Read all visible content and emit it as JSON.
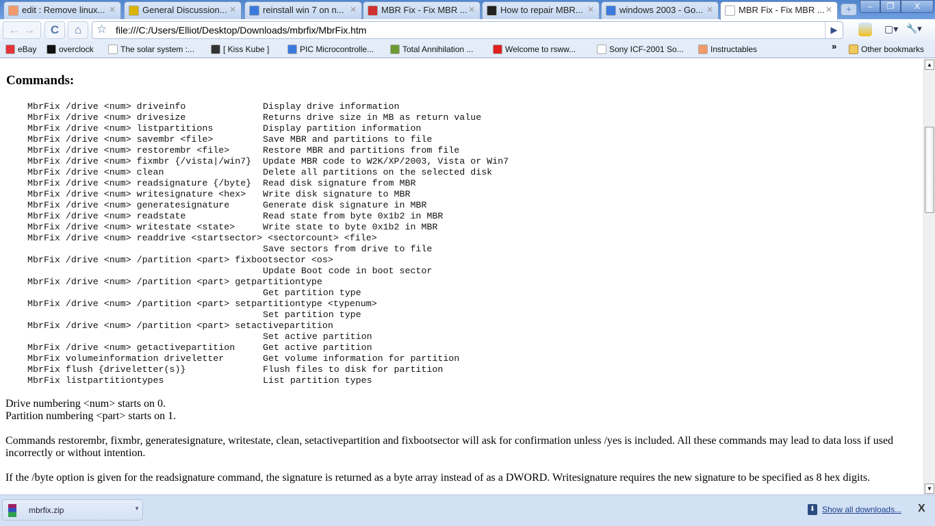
{
  "tabs": [
    {
      "title": "edit : Remove linux...",
      "icon": "instructables-icon",
      "color": "#f39a6b"
    },
    {
      "title": "General Discussion...",
      "icon": "k-logo-icon",
      "color": "#d8b400"
    },
    {
      "title": "reinstall win 7 on n...",
      "icon": "google-icon",
      "color": "#3a7ae0"
    },
    {
      "title": "MBR Fix - Fix MBR ...",
      "icon": "mbrfix-icon",
      "color": "#d03030"
    },
    {
      "title": "How to repair MBR...",
      "icon": "circle-logo-icon",
      "color": "#222222"
    },
    {
      "title": "windows 2003 - Go...",
      "icon": "google-icon",
      "color": "#3a7ae0"
    },
    {
      "title": "MBR Fix - Fix MBR ...",
      "icon": "page-icon",
      "color": "#ffffff",
      "active": true
    }
  ],
  "window_controls": {
    "minimize": "–",
    "maximize": "❐",
    "close": "X"
  },
  "toolbar": {
    "back": "←",
    "forward": "→",
    "reload": "C",
    "home": "⌂",
    "url": "file:///C:/Users/Elliot/Desktop/Downloads/mbrfix/MbrFix.htm",
    "go": "▶",
    "page": "▢▾",
    "wrench": "🔧▾"
  },
  "bookmarks": [
    {
      "label": "eBay",
      "color": "#e53238"
    },
    {
      "label": "overclock",
      "color": "#111111"
    },
    {
      "label": "The solar system :...",
      "color": "#ffffff"
    },
    {
      "label": "[  Kiss Kube  ]",
      "color": "#333333"
    },
    {
      "label": "PIC Microcontrolle...",
      "color": "#3a7ae0"
    },
    {
      "label": "Total Annihilation ...",
      "color": "#6a9a30"
    },
    {
      "label": "Welcome to rsww...",
      "color": "#e02020"
    },
    {
      "label": "Sony ICF-2001 So...",
      "color": "#ffffff"
    },
    {
      "label": "Instructables",
      "color": "#f39a6b"
    }
  ],
  "bookmarks_more": "»",
  "other_bookmarks": "Other bookmarks",
  "content": {
    "heading": "Commands:",
    "commands": [
      [
        "MbrFix /drive <num> driveinfo",
        "Display drive information"
      ],
      [
        "MbrFix /drive <num> drivesize",
        "Returns drive size in MB as return value"
      ],
      [
        "MbrFix /drive <num> listpartitions",
        "Display partition information"
      ],
      [
        "MbrFix /drive <num> savembr <file>",
        "Save MBR and partitions to file"
      ],
      [
        "MbrFix /drive <num> restorembr <file>",
        "Restore MBR and partitions from file"
      ],
      [
        "MbrFix /drive <num> fixmbr {/vista|/win7}",
        "Update MBR code to W2K/XP/2003, Vista or Win7"
      ],
      [
        "MbrFix /drive <num> clean",
        "Delete all partitions on the selected disk"
      ],
      [
        "MbrFix /drive <num> readsignature {/byte}",
        "Read disk signature from MBR"
      ],
      [
        "MbrFix /drive <num> writesignature <hex>",
        "Write disk signature to MBR"
      ],
      [
        "MbrFix /drive <num> generatesignature",
        "Generate disk signature in MBR"
      ],
      [
        "MbrFix /drive <num> readstate",
        "Read state from byte 0x1b2 in MBR"
      ],
      [
        "MbrFix /drive <num> writestate <state>",
        "Write state to byte 0x1b2 in MBR"
      ],
      [
        "MbrFix /drive <num> readdrive <startsector> <sectorcount> <file>",
        ""
      ],
      [
        "",
        "Save sectors from drive to file"
      ],
      [
        "MbrFix /drive <num> /partition <part> fixbootsector <os>",
        ""
      ],
      [
        "",
        "Update Boot code in boot sector"
      ],
      [
        "MbrFix /drive <num> /partition <part> getpartitiontype",
        ""
      ],
      [
        "",
        "Get partition type"
      ],
      [
        "MbrFix /drive <num> /partition <part> setpartitiontype <typenum>",
        ""
      ],
      [
        "",
        "Set partition type"
      ],
      [
        "MbrFix /drive <num> /partition <part> setactivepartition",
        ""
      ],
      [
        "",
        "Set active partition"
      ],
      [
        "MbrFix /drive <num> getactivepartition",
        "Get active partition"
      ],
      [
        "MbrFix volumeinformation driveletter",
        "Get volume information for partition"
      ],
      [
        "MbrFix flush {driveletter(s)}",
        "Flush files to disk for partition"
      ],
      [
        "MbrFix listpartitiontypes",
        "List partition types"
      ]
    ],
    "para1_line1": "Drive numbering <num> starts on 0.",
    "para1_line2": "Partition numbering <part> starts on 1.",
    "para2": "Commands restorembr, fixmbr, generatesignature, writestate, clean, setactivepartition and fixbootsector will ask for confirmation unless /yes is included. All these commands may lead to data loss if used incorrectly or without intention.",
    "para3": "If the /byte option is given for the readsignature command, the signature is returned as a byte array instead of as a DWORD. Writesignature requires the new signature to be specified as 8 hex digits."
  },
  "downloads": {
    "file": "mbrfix.zip",
    "show_all": "Show all downloads...",
    "close": "X"
  }
}
